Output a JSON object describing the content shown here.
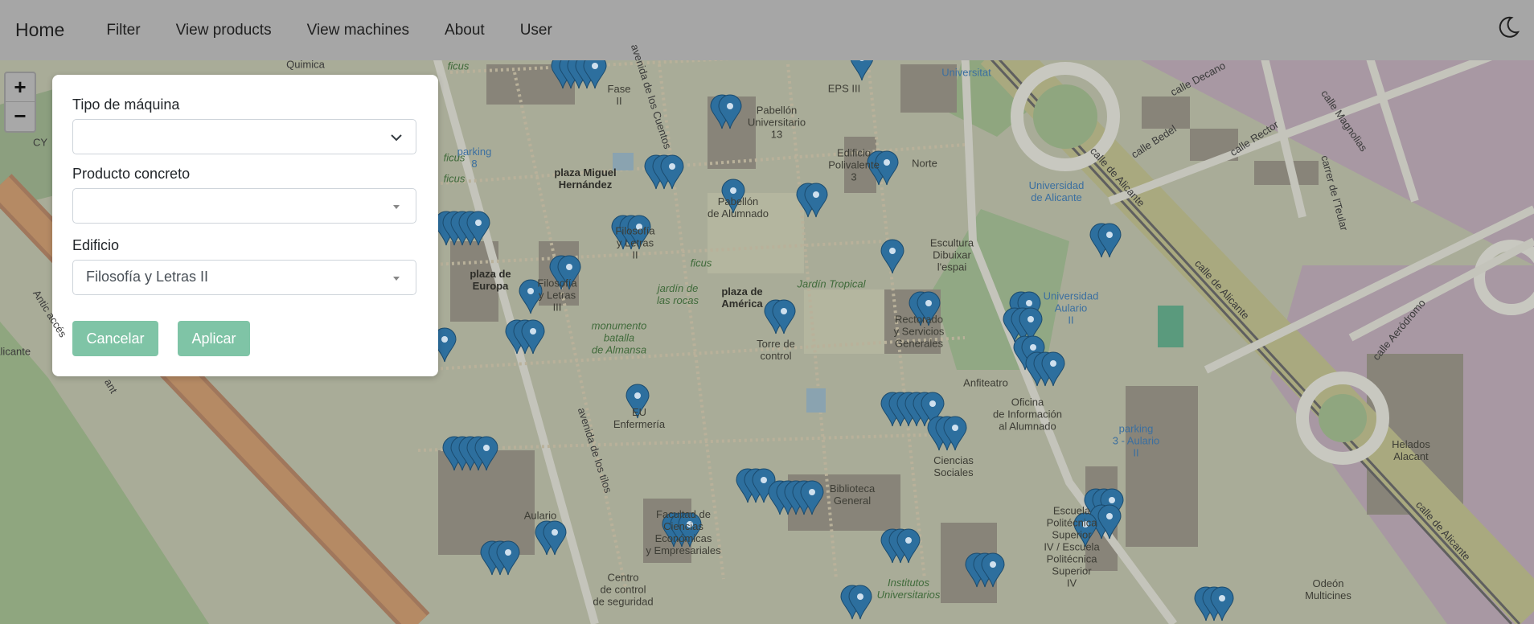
{
  "navbar": {
    "brand": "Home",
    "links": [
      "Filter",
      "View products",
      "View machines",
      "About",
      "User"
    ],
    "theme_icon": "moon-icon"
  },
  "zoom": {
    "in_label": "+",
    "out_label": "−"
  },
  "filter_panel": {
    "machine_type": {
      "label": "Tipo de máquina",
      "value": ""
    },
    "product": {
      "label": "Producto concreto",
      "value": ""
    },
    "building": {
      "label": "Edificio",
      "value": "Filosofía y Letras II"
    },
    "cancel_label": "Cancelar",
    "apply_label": "Aplicar",
    "button_color": "#7fc4a6"
  },
  "map": {
    "labels": [
      "Fase\nII",
      "EPS III",
      "Pabellón\nUniversitario\n13",
      "Universitat",
      "Edificio\nPolivalente\n3",
      "Norte",
      "plaza Miguel\nHernández",
      "Pabellón\nde Alumnado",
      "parking\n8",
      "ficus",
      "ficus",
      "ficus",
      "ficus",
      "Filosofía\ny Letras\nII",
      "Escultura\nDibuixar\nl'espai",
      "Universidad\nde Alicante",
      "plaza de\nEuropa",
      "Filosofía\ny Letras\nIII",
      "jardín de\nlas rocas",
      "plaza de\nAmérica",
      "Jardín Tropical",
      "Rectorado\ny Servicios\nGenerales",
      "Universidad\nAulario\nII",
      "monumento\nbatalla\nde Almansa",
      "Torre de\ncontrol",
      "Anfiteatro",
      "Oficina\nde Información\nal Alumnado",
      "EU\nEnfermería",
      "Biblioteca\nGeneral",
      "Ciencias\nSociales",
      "parking\n3 - Aulario\nII",
      "Helados\nAlacant",
      "Aulario",
      "Facultad de\nCiencias\nEconómicas\ny Empresariales",
      "Escuela\nPolitécnica\nSuperior\nIV / Escuela\nPolitécnica\nSuperior\nIV",
      "Institutos\nUniversitarios",
      "Centro\nde control\nde seguridad",
      "Odeón\nMulticines",
      "avenida de los tilos",
      "avenida de los Cuentos",
      "calle de Alicante",
      "calle de Alicante",
      "calle de Alicante",
      "calle Bedel",
      "calle Rector",
      "calle Decano",
      "calle Magnolias",
      "carrer de l'Teular",
      "calle Aeródromo",
      "Antic accés",
      "Alicante",
      "ant",
      "Quimica",
      "CY"
    ]
  }
}
